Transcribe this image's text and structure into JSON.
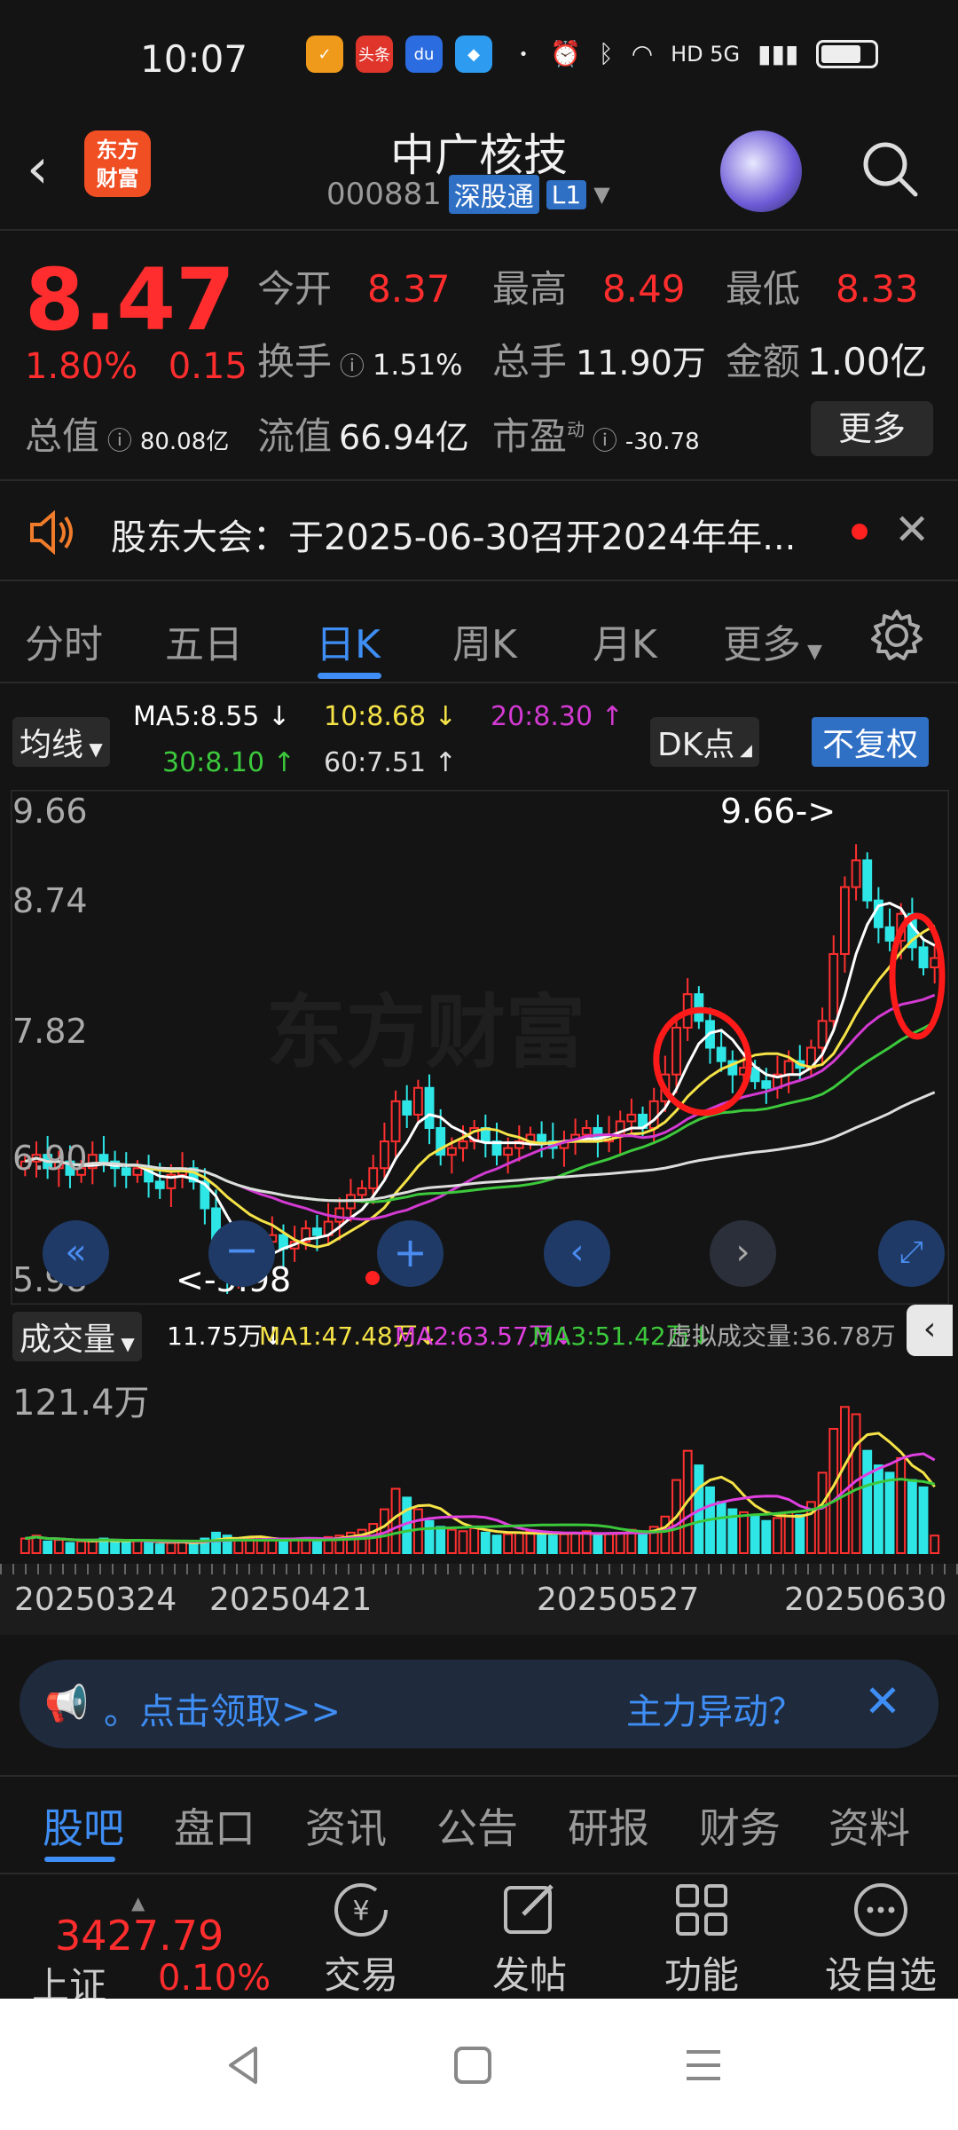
{
  "status": {
    "time": "10:07",
    "app_icons": [
      "头条"
    ],
    "network": "HD 5G"
  },
  "header": {
    "app_logo": "东方\n财富",
    "stock_name": "中广核技",
    "stock_code": "000881",
    "market_badge": "深股通",
    "level_badge": "L1"
  },
  "quote": {
    "price": "8.47",
    "change_pct": "1.80%",
    "change_amt": "0.15",
    "open_label": "今开",
    "open": "8.37",
    "high_label": "最高",
    "high": "8.49",
    "low_label": "最低",
    "low": "8.33",
    "turnover_label": "换手",
    "turnover": "1.51%",
    "volume_label": "总手",
    "volume": "11.90万",
    "amount_label": "金额",
    "amount": "1.00亿",
    "mktcap_label": "总值",
    "mktcap": "80.08亿",
    "float_label": "流值",
    "float": "66.94亿",
    "pe_label": "市盈",
    "pe_sup": "动",
    "pe": "-30.78",
    "more": "更多"
  },
  "notice": {
    "text": "股东大会：于2025-06-30召开2024年年..."
  },
  "ktabs": [
    "分时",
    "五日",
    "日K",
    "周K",
    "月K",
    "更多"
  ],
  "ma": {
    "selector": "均线",
    "ma5": "MA5:8.55",
    "ma10": "10:8.68",
    "ma20": "20:8.30",
    "ma30": "30:8.10",
    "ma60": "60:7.51",
    "dk": "DK点",
    "adjust": "不复权",
    "colors": {
      "ma5": "#ffffff",
      "ma10": "#f5e347",
      "ma20": "#d23ad2",
      "ma30": "#3cc93c",
      "ma60": "#dddddd"
    }
  },
  "chart_labels": {
    "y_ticks": [
      "9.66",
      "8.74",
      "7.82",
      "6.90",
      "5.98"
    ],
    "max_label": "9.66->",
    "min_label": "<-5.98",
    "watermark": "东方财富"
  },
  "volume": {
    "selector": "成交量",
    "cur": "11.75万",
    "ma1": "MA1:47.48万",
    "ma2": "MA2:63.57万",
    "ma3": "MA3:51.42万",
    "virtual": "虚拟成交量:36.78万",
    "y_top": "121.4万"
  },
  "dates": [
    "20250324",
    "20250421",
    "20250527",
    "20250630"
  ],
  "banner": {
    "left": "。点击领取>>",
    "right": "主力异动？"
  },
  "btabs": [
    "股吧",
    "盘口",
    "资讯",
    "公告",
    "研报",
    "财务",
    "资料"
  ],
  "toolbar": {
    "index_value": "3427.79",
    "index_name": "上证",
    "index_pct": "0.10%",
    "items": [
      "交易",
      "发帖",
      "功能",
      "设自选"
    ]
  },
  "chart_data": {
    "type": "candlestick",
    "y_range": [
      5.98,
      9.66
    ],
    "max": 9.66,
    "min": 5.98,
    "ma_lines": [
      "MA5",
      "MA10",
      "MA20",
      "MA30",
      "MA60"
    ],
    "current": {
      "MA5": 8.55,
      "MA10": 8.68,
      "MA20": 8.3,
      "MA30": 8.1,
      "MA60": 7.51
    },
    "close_series": [
      6.95,
      7.0,
      6.9,
      6.95,
      6.85,
      6.9,
      7.0,
      6.95,
      6.9,
      6.85,
      6.9,
      6.8,
      6.75,
      6.85,
      6.9,
      6.8,
      6.6,
      6.3,
      6.1,
      6.2,
      6.25,
      6.35,
      6.4,
      6.3,
      6.35,
      6.45,
      6.4,
      6.5,
      6.6,
      6.7,
      6.75,
      6.9,
      7.1,
      7.4,
      7.3,
      7.5,
      7.2,
      7.0,
      7.05,
      7.1,
      7.2,
      7.1,
      7.0,
      7.05,
      7.1,
      7.15,
      7.1,
      7.05,
      7.1,
      7.15,
      7.2,
      7.1,
      7.15,
      7.25,
      7.3,
      7.2,
      7.4,
      7.6,
      7.95,
      8.2,
      8.0,
      7.8,
      7.7,
      7.6,
      7.65,
      7.55,
      7.5,
      7.6,
      7.7,
      7.65,
      7.8,
      8.0,
      8.5,
      9.0,
      9.2,
      8.9,
      8.7,
      8.6,
      8.8,
      8.55,
      8.4,
      8.47
    ],
    "volume_series": [
      10,
      12,
      8,
      9,
      7,
      8,
      9,
      10,
      8,
      7,
      9,
      8,
      6,
      7,
      8,
      6,
      10,
      14,
      12,
      9,
      10,
      11,
      9,
      8,
      9,
      10,
      9,
      11,
      12,
      14,
      16,
      20,
      30,
      44,
      38,
      30,
      22,
      18,
      16,
      15,
      17,
      14,
      12,
      13,
      14,
      15,
      14,
      12,
      13,
      14,
      15,
      12,
      13,
      14,
      16,
      15,
      18,
      25,
      50,
      70,
      60,
      45,
      35,
      30,
      28,
      25,
      22,
      24,
      28,
      26,
      35,
      55,
      85,
      100,
      95,
      70,
      60,
      55,
      65,
      50,
      45,
      12
    ]
  }
}
